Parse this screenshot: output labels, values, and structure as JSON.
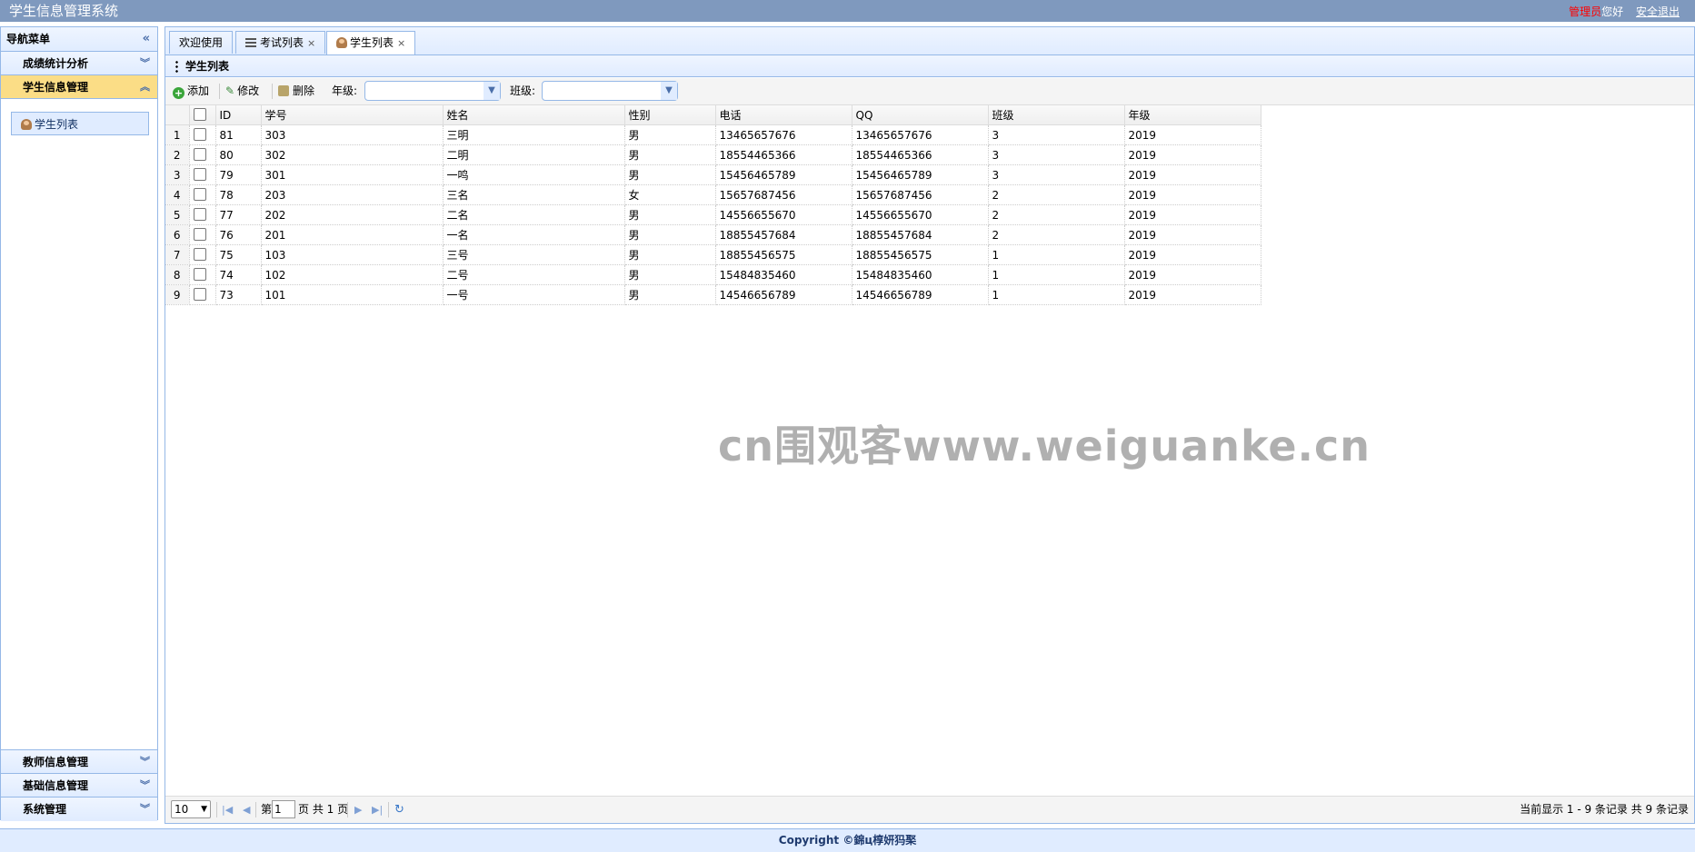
{
  "header": {
    "app_title": "学生信息管理系统",
    "role": "管理员",
    "greeting": "您好",
    "logout": "安全退出"
  },
  "sidebar": {
    "title": "导航菜单",
    "sections": [
      {
        "label": "成绩统计分析",
        "expanded": false
      },
      {
        "label": "学生信息管理",
        "expanded": true,
        "items": [
          {
            "label": "学生列表",
            "icon": "person-icon"
          }
        ]
      },
      {
        "label": "教师信息管理",
        "expanded": false
      },
      {
        "label": "基础信息管理",
        "expanded": false
      },
      {
        "label": "系统管理",
        "expanded": false
      }
    ]
  },
  "tabs": [
    {
      "label": "欢迎使用",
      "closable": false
    },
    {
      "label": "考试列表",
      "closable": true,
      "icon": "list-icon"
    },
    {
      "label": "学生列表",
      "closable": true,
      "icon": "person-icon",
      "active": true
    }
  ],
  "panel": {
    "title": "学生列表"
  },
  "toolbar": {
    "add": "添加",
    "edit": "修改",
    "delete": "删除",
    "grade_label": "年级:",
    "grade_value": "",
    "class_label": "班级:",
    "class_value": ""
  },
  "grid": {
    "columns": [
      "ID",
      "学号",
      "姓名",
      "性别",
      "电话",
      "QQ",
      "班级",
      "年级"
    ],
    "rows": [
      {
        "n": "1",
        "id": "81",
        "sno": "303",
        "name": "三明",
        "sex": "男",
        "phone": "13465657676",
        "qq": "13465657676",
        "cls": "3",
        "grade": "2019"
      },
      {
        "n": "2",
        "id": "80",
        "sno": "302",
        "name": "二明",
        "sex": "男",
        "phone": "18554465366",
        "qq": "18554465366",
        "cls": "3",
        "grade": "2019"
      },
      {
        "n": "3",
        "id": "79",
        "sno": "301",
        "name": "一鸣",
        "sex": "男",
        "phone": "15456465789",
        "qq": "15456465789",
        "cls": "3",
        "grade": "2019"
      },
      {
        "n": "4",
        "id": "78",
        "sno": "203",
        "name": "三名",
        "sex": "女",
        "phone": "15657687456",
        "qq": "15657687456",
        "cls": "2",
        "grade": "2019"
      },
      {
        "n": "5",
        "id": "77",
        "sno": "202",
        "name": "二名",
        "sex": "男",
        "phone": "14556655670",
        "qq": "14556655670",
        "cls": "2",
        "grade": "2019"
      },
      {
        "n": "6",
        "id": "76",
        "sno": "201",
        "name": "一名",
        "sex": "男",
        "phone": "18855457684",
        "qq": "18855457684",
        "cls": "2",
        "grade": "2019"
      },
      {
        "n": "7",
        "id": "75",
        "sno": "103",
        "name": "三号",
        "sex": "男",
        "phone": "18855456575",
        "qq": "18855456575",
        "cls": "1",
        "grade": "2019"
      },
      {
        "n": "8",
        "id": "74",
        "sno": "102",
        "name": "二号",
        "sex": "男",
        "phone": "15484835460",
        "qq": "15484835460",
        "cls": "1",
        "grade": "2019"
      },
      {
        "n": "9",
        "id": "73",
        "sno": "101",
        "name": "一号",
        "sex": "男",
        "phone": "14546656789",
        "qq": "14546656789",
        "cls": "1",
        "grade": "2019"
      }
    ]
  },
  "pager": {
    "page_size": "10",
    "page_prefix": "第",
    "page_current": "1",
    "page_suffix": "页 共 1 页",
    "info": "当前显示 1 - 9 条记录 共 9 条记录"
  },
  "watermark": "cn围观客www.weiguanke.cn",
  "footer": {
    "copyright": "Copyright ©錦ц椁妍犸棸"
  }
}
